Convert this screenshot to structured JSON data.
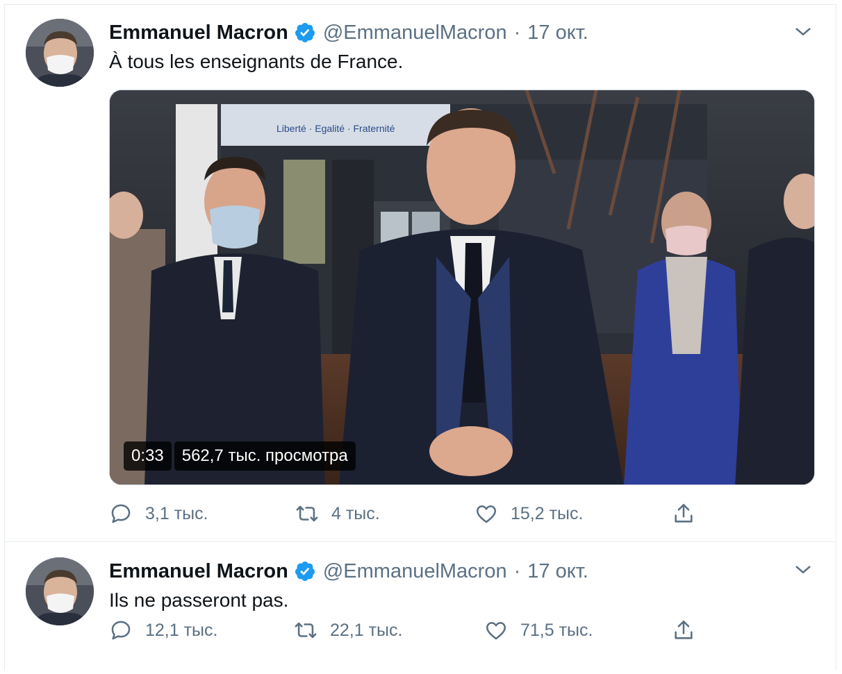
{
  "colors": {
    "verified": "#1d9bf0",
    "muted": "#5b7083",
    "border": "#e6ecf0"
  },
  "tweets": [
    {
      "author": "Emmanuel Macron",
      "handle": "@EmmanuelMacron",
      "separator": "·",
      "date": "17 окт.",
      "text": "À tous les enseignants de France.",
      "video": {
        "duration": "0:33",
        "views": "562,7 тыс. просмотра"
      },
      "actions": {
        "replies": "3,1 тыс.",
        "retweets": "4 тыс.",
        "likes": "15,2 тыс."
      }
    },
    {
      "author": "Emmanuel Macron",
      "handle": "@EmmanuelMacron",
      "separator": "·",
      "date": "17 окт.",
      "text": "Ils ne passeront pas.",
      "actions": {
        "replies": "12,1 тыс.",
        "retweets": "22,1 тыс.",
        "likes": "71,5 тыс."
      }
    }
  ],
  "icons": [
    "verified-badge-icon",
    "chevron-down-icon",
    "reply-icon",
    "retweet-icon",
    "like-icon",
    "share-icon"
  ]
}
